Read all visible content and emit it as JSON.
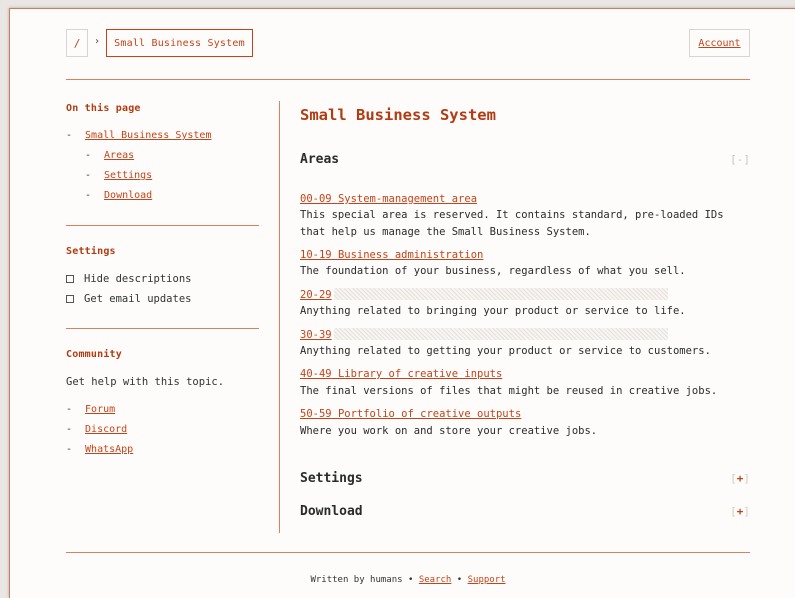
{
  "header": {
    "root_label": "/",
    "separator": "›",
    "current": "Small Business System",
    "account": "Account"
  },
  "sidebar": {
    "toc_heading": "On this page",
    "toc": [
      {
        "label": "Small Business System"
      },
      {
        "label": "Areas"
      },
      {
        "label": "Settings"
      },
      {
        "label": "Download"
      }
    ],
    "settings_heading": "Settings",
    "settings": [
      {
        "label": "Hide descriptions",
        "checked": false
      },
      {
        "label": "Get email updates",
        "checked": false
      }
    ],
    "community_heading": "Community",
    "community_text": "Get help with this topic.",
    "community_links": [
      {
        "label": "Forum"
      },
      {
        "label": "Discord"
      },
      {
        "label": "WhatsApp"
      }
    ],
    "dash": "-"
  },
  "main": {
    "title": "Small Business System",
    "areas_heading": "Areas",
    "areas_toggle": "[-]",
    "areas": [
      {
        "code": "00-09",
        "name": "System-management area",
        "desc": "This special area is reserved. It contains standard, pre-loaded IDs that help us manage the Small Business System."
      },
      {
        "code": "10-19",
        "name": "Business administration",
        "desc": "The foundation of your business, regardless of what you sell."
      },
      {
        "code": "20-29",
        "name": "",
        "desc": "Anything related to bringing your product or service to life."
      },
      {
        "code": "30-39",
        "name": "",
        "desc": "Anything related to getting your product or service to customers."
      },
      {
        "code": "40-49",
        "name": "Library of creative inputs",
        "desc": "The final versions of files that might be reused in creative jobs."
      },
      {
        "code": "50-59",
        "name": "Portfolio of creative outputs",
        "desc": "Where you work on and store your creative jobs."
      }
    ],
    "settings_heading": "Settings",
    "settings_toggle": "+",
    "download_heading": "Download",
    "download_toggle": "+"
  },
  "footer": {
    "text": "Written by humans",
    "bullet": "•",
    "search": "Search",
    "support": "Support"
  },
  "colors": {
    "accent": "#c4441a",
    "rule": "#d8825d",
    "background": "#fdfcfa"
  }
}
